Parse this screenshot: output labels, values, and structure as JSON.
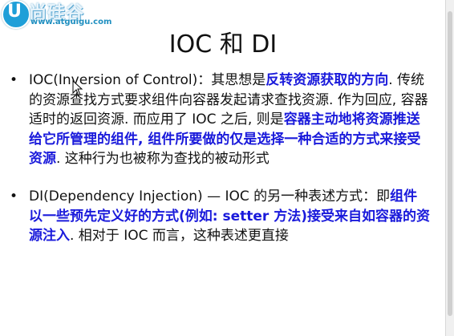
{
  "logo": {
    "mark": "U",
    "name": "尚硅谷",
    "url": "www.atguigu.com"
  },
  "slide": {
    "title": "IOC 和 DI",
    "bullets": [
      {
        "segments": [
          {
            "text": "IOC(Inversion of Control)：其思想是",
            "style": "normal"
          },
          {
            "text": "反转资源获取的方向",
            "style": "highlight"
          },
          {
            "text": ". 传统的资源查找方式要求组件向容器发起请求查找资源. 作为回应, 容器适时的返回资源. 而应用了 IOC 之后, 则是",
            "style": "normal"
          },
          {
            "text": "容器主动地将资源推送给它所管理的组件, 组件所要做的仅是选择一种合适的方式来接受资源",
            "style": "highlight"
          },
          {
            "text": ". 这种行为也被称为查找的被动形式",
            "style": "normal"
          }
        ]
      },
      {
        "segments": [
          {
            "text": "DI(Dependency Injection) — IOC 的另一种表述方式：即",
            "style": "normal"
          },
          {
            "text": "组件以一些预先定义好的方式(例如: setter 方法)接受来自如容器的资源注入",
            "style": "highlight"
          },
          {
            "text": ". 相对于 IOC 而言，这种表述更直接",
            "style": "normal"
          }
        ]
      }
    ]
  },
  "colors": {
    "highlight": "#1a1adb",
    "text": "#111111",
    "logo_blue": "#1e9fd8"
  }
}
